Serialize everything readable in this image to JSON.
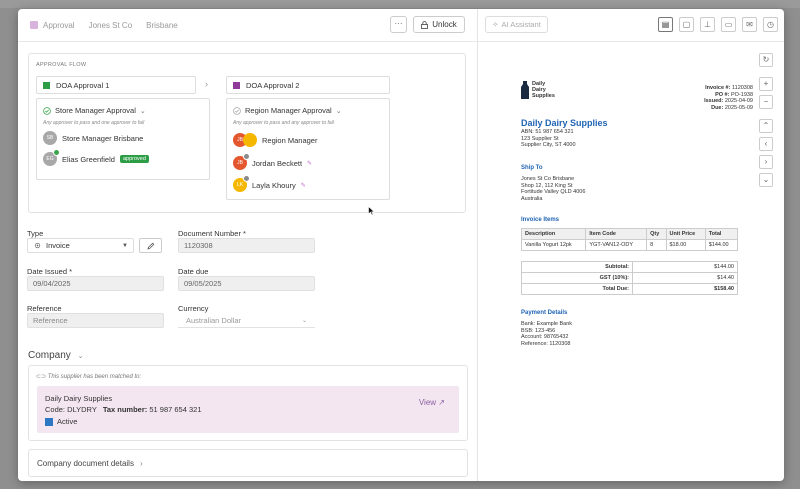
{
  "header": {
    "status_label": "Approval",
    "breadcrumb": [
      "Jones St Co",
      "Brisbane"
    ],
    "more_label": "···",
    "unlock_label": "Unlock"
  },
  "approval_flow": {
    "title": "APPROVAL FLOW",
    "steps": [
      {
        "name": "DOA Approval 1",
        "color": "#2e9e46",
        "card_title": "Store Manager Approval",
        "card_sub": "Any approver to pass and one approver to fail",
        "approvers": [
          {
            "initials": "SB",
            "name": "Store Manager Brisbane"
          },
          {
            "initials": "EG",
            "name": "Elias Greenfield",
            "badge": "approved"
          }
        ]
      },
      {
        "name": "DOA Approval 2",
        "color": "#8e3b9a",
        "card_title": "Region Manager Approval",
        "card_sub": "Any approver to pass and any approver to fail",
        "approvers": [
          {
            "initials": "JB",
            "name": "Region Manager"
          },
          {
            "initials": "JB",
            "name": "Jordan Beckett"
          },
          {
            "initials": "LK",
            "name": "Layla Khoury"
          }
        ]
      }
    ]
  },
  "form": {
    "type_label": "Type",
    "type_value": "Invoice",
    "doc_number_label": "Document Number *",
    "doc_number_value": "1120308",
    "date_issued_label": "Date Issued *",
    "date_issued_value": "09/04/2025",
    "date_due_label": "Date due",
    "date_due_value": "09/05/2025",
    "reference_label": "Reference",
    "reference_placeholder": "Reference",
    "currency_label": "Currency",
    "currency_value": "Australian Dollar"
  },
  "company": {
    "title": "Company",
    "match_note": "This supplier has been matched to:",
    "name": "Daily Dairy Supplies",
    "code_label": "Code:",
    "code_value": "DLYDRY",
    "tax_label": "Tax number:",
    "tax_value": "51 987 654 321",
    "status": "Active",
    "view_label": "View",
    "doc_details_label": "Company document details"
  },
  "viewer": {
    "ai_label": "AI Assistant"
  },
  "invoice": {
    "logo_text": [
      "Daily",
      "Dairy",
      "Supplies"
    ],
    "brand": "Daily Dairy Supplies",
    "abn": "ABN: 51 987 654 321",
    "addr1": "123 Supplier St",
    "addr2": "Supplier City, ST 4000",
    "meta": [
      {
        "label": "Invoice #:",
        "value": "1120308"
      },
      {
        "label": "PO #:",
        "value": "PO-1938"
      },
      {
        "label": "Issued:",
        "value": "2025-04-09"
      },
      {
        "label": "Due:",
        "value": "2025-05-09"
      }
    ],
    "ship_to_title": "Ship To",
    "ship_to": [
      "Jones St Co Brisbane",
      "Shop 12, 112 King St",
      "Fortitude Valley QLD 4006",
      "Australia"
    ],
    "items_title": "Invoice Items",
    "columns": [
      "Description",
      "Item Code",
      "Qty",
      "Unit Price",
      "Total"
    ],
    "rows": [
      [
        "Vanilla Yogurt 12pk",
        "YGT-VAN12-ODY",
        "8",
        "$18.00",
        "$144.00"
      ]
    ],
    "totals": [
      {
        "label": "Subtotal:",
        "value": "$144.00"
      },
      {
        "label": "GST (10%):",
        "value": "$14.40"
      },
      {
        "label": "Total Due:",
        "value": "$158.40"
      }
    ],
    "payment_title": "Payment Details",
    "payment": [
      "Bank: Example Bank",
      "BSB: 123-456",
      "Account: 98765432",
      "Reference: 1120308"
    ]
  }
}
